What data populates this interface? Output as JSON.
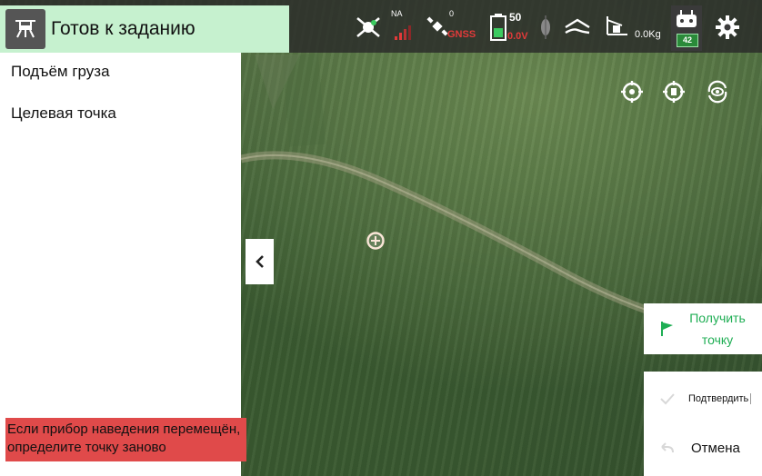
{
  "status": {
    "title": "Готов к заданию"
  },
  "topbar": {
    "rtk_label": "NA",
    "gnss_count": "0",
    "gnss_label": "GNSS",
    "battery_percent": "50",
    "battery_voltage": "0.0V",
    "payload_weight": "0.0Kg",
    "remote_battery": "42"
  },
  "left_panel": {
    "items": [
      "Подъём груза",
      "Целевая точка"
    ],
    "warning_line1": "Если прибор наведения перемещён,",
    "warning_line2": "определите точку заново"
  },
  "actions": {
    "get_point_line1": "Получить",
    "get_point_line2": "точку",
    "confirm_label": "Подтвердить",
    "cancel_label": "Отмена"
  },
  "colors": {
    "status_bg": "#c6f1cf",
    "accent_green": "#1fae54",
    "warning_red": "#e04a4a",
    "alert_red": "#e23a3a"
  }
}
